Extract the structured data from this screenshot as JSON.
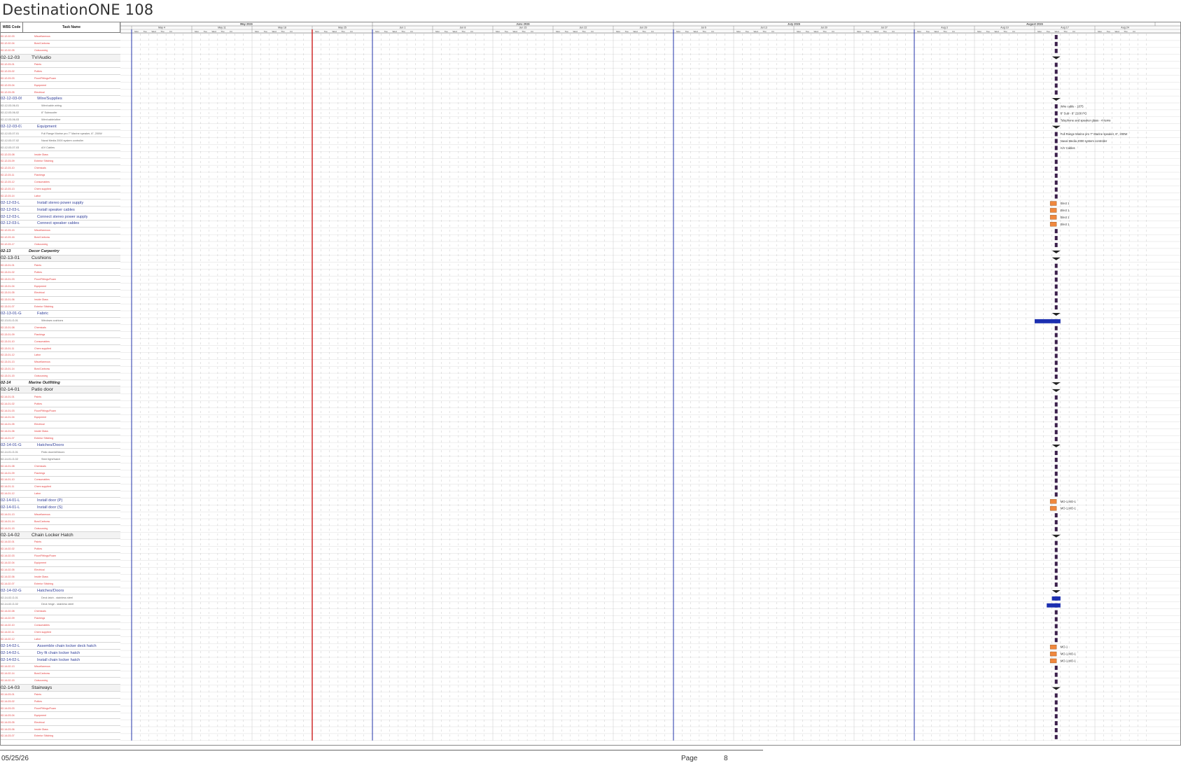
{
  "document": {
    "title": "DestinationONE 108",
    "footer": {
      "date": "05/25/26",
      "page_label": "Page",
      "page_number": "8"
    },
    "columns": {
      "wbs": "WBS Code",
      "task": "Task Name"
    },
    "months": [
      "May 2026",
      "June 2026",
      "July 2026",
      "August 2026"
    ],
    "weeks": [
      "May 4",
      "May 11",
      "May 18",
      "May 25",
      "Jun 1",
      "Jun 8",
      "Jun 15",
      "Jun 22",
      "Jun 29",
      "Jul 6",
      "Jul 13",
      "Jul 20",
      "Jul 27",
      "Aug 3",
      "Aug 10",
      "Aug 17",
      "Aug 24"
    ],
    "days": [
      "Mon",
      "Tue",
      "Wed",
      "Thu",
      "Fri"
    ],
    "colors": {
      "task_bar": "#f0883e",
      "progress_bar": "#1c2fb0",
      "milestone": "#3a1e4a",
      "today_line": "#cc1d1d",
      "month_line": "#2233aa"
    }
  },
  "rows": [
    {
      "code": "02-12-02-03",
      "name": "Miscellaneous",
      "kind": "sub"
    },
    {
      "code": "02-12-02-04",
      "name": "Bow/Carbonw",
      "kind": "sub"
    },
    {
      "code": "02-12-02-05",
      "name": "Outsourcing",
      "kind": "sub"
    },
    {
      "code": "02-12-03",
      "name": "TV/Audio",
      "kind": "sec"
    },
    {
      "code": "02-12-03-01",
      "name": "Paints",
      "kind": "sub"
    },
    {
      "code": "02-12-03-02",
      "name": "Putties",
      "kind": "sub"
    },
    {
      "code": "02-12-03-03",
      "name": "Floor/Fittings/Foam",
      "kind": "sub"
    },
    {
      "code": "02-12-03-04",
      "name": "Equipment",
      "kind": "sub"
    },
    {
      "code": "02-12-03-05",
      "name": "Electrical",
      "kind": "sub"
    },
    {
      "code": "02-12-03-06",
      "name": "Wire/Supplies",
      "kind": "grp"
    },
    {
      "code": "02-12-03-06-01",
      "name": "Wire/cable wiring",
      "kind": "item",
      "label": "Wire cable - 1875"
    },
    {
      "code": "02-12-03-06-02",
      "name": "8\" Subwoofer",
      "kind": "item",
      "label": "8\" Sub - 8\" 2100 PG"
    },
    {
      "code": "02-12-03-06-03",
      "name": "Wire/cable/other",
      "kind": "item",
      "label": "Telephone and speaker glass - 4 items"
    },
    {
      "code": "02-12-03-07",
      "name": "Equipment",
      "kind": "grp"
    },
    {
      "code": "02-12-03-07-01",
      "name": "Full Range Marine pro 7\" Marine speaker, 6\", 200W",
      "kind": "item",
      "label": "Full Range Marine pro 7\" Marine speaker, 6\", 200W"
    },
    {
      "code": "02-12-03-07-02",
      "name": "Naval Media 2000 system controller",
      "kind": "item",
      "label": "Naval Media 2000 system controller"
    },
    {
      "code": "02-12-03-07-03",
      "name": "A/V Cables",
      "kind": "item",
      "label": "A/V Cables"
    },
    {
      "code": "02-12-03-08",
      "name": "Inside Glass",
      "kind": "sub"
    },
    {
      "code": "02-12-03-09",
      "name": "Exterior Stitching",
      "kind": "sub"
    },
    {
      "code": "02-12-03-10",
      "name": "Chemicals",
      "kind": "sub"
    },
    {
      "code": "02-12-03-11",
      "name": "Flashings",
      "kind": "sub"
    },
    {
      "code": "02-12-03-12",
      "name": "Consumables",
      "kind": "sub"
    },
    {
      "code": "02-12-03-13",
      "name": "Chem supplied",
      "kind": "sub"
    },
    {
      "code": "02-12-03-14",
      "name": "Labor",
      "kind": "sub"
    },
    {
      "code": "02-12-03-L",
      "name": "Install stereo power supply",
      "kind": "task",
      "label": "Elect 1"
    },
    {
      "code": "02-12-03-L",
      "name": "Install speaker cables",
      "kind": "task",
      "label": "Elect 1"
    },
    {
      "code": "02-12-03-L",
      "name": "Connect stereo power supply",
      "kind": "task",
      "label": "Elect 1"
    },
    {
      "code": "02-12-03-L",
      "name": "Connect speaker cables",
      "kind": "task",
      "label": "Elect 1"
    },
    {
      "code": "02-12-03-15",
      "name": "Miscellaneous",
      "kind": "sub"
    },
    {
      "code": "02-12-03-16",
      "name": "Bow/Carbonw",
      "kind": "sub"
    },
    {
      "code": "02-12-03-17",
      "name": "Outsourcing",
      "kind": "sub"
    },
    {
      "code": "02-13",
      "name": "Decor Carpentry",
      "kind": "bold"
    },
    {
      "code": "02-13-01",
      "name": "Cushions",
      "kind": "sec"
    },
    {
      "code": "02-13-01-01",
      "name": "Paints",
      "kind": "sub"
    },
    {
      "code": "02-13-01-02",
      "name": "Putties",
      "kind": "sub"
    },
    {
      "code": "02-13-01-03",
      "name": "Floor/Fittings/Foam",
      "kind": "sub"
    },
    {
      "code": "02-13-01-04",
      "name": "Equipment",
      "kind": "sub"
    },
    {
      "code": "02-13-01-05",
      "name": "Electrical",
      "kind": "sub"
    },
    {
      "code": "02-13-01-06",
      "name": "Inside Glass",
      "kind": "sub"
    },
    {
      "code": "02-13-01-07",
      "name": "Exterior Stitching",
      "kind": "sub"
    },
    {
      "code": "02-13-01-G",
      "name": "Fabric",
      "kind": "grp"
    },
    {
      "code": "02-13-01-G-01",
      "name": "Windows cushions",
      "kind": "item"
    },
    {
      "code": "02-13-01-08",
      "name": "Chemicals",
      "kind": "sub"
    },
    {
      "code": "02-13-01-09",
      "name": "Flashings",
      "kind": "sub"
    },
    {
      "code": "02-13-01-10",
      "name": "Consumables",
      "kind": "sub"
    },
    {
      "code": "02-13-01-11",
      "name": "Chem supplied",
      "kind": "sub"
    },
    {
      "code": "02-13-01-12",
      "name": "Labor",
      "kind": "sub"
    },
    {
      "code": "02-13-01-13",
      "name": "Miscellaneous",
      "kind": "sub"
    },
    {
      "code": "02-13-01-14",
      "name": "Bow/Carbonw",
      "kind": "sub"
    },
    {
      "code": "02-13-01-15",
      "name": "Outsourcing",
      "kind": "sub"
    },
    {
      "code": "02-14",
      "name": "Marine Outfitting",
      "kind": "bold"
    },
    {
      "code": "02-14-01",
      "name": "Patio door",
      "kind": "sec"
    },
    {
      "code": "02-14-01-01",
      "name": "Paints",
      "kind": "sub"
    },
    {
      "code": "02-14-01-02",
      "name": "Putties",
      "kind": "sub"
    },
    {
      "code": "02-14-01-03",
      "name": "Floor/Fittings/Foam",
      "kind": "sub"
    },
    {
      "code": "02-14-01-04",
      "name": "Equipment",
      "kind": "sub"
    },
    {
      "code": "02-14-01-05",
      "name": "Electrical",
      "kind": "sub"
    },
    {
      "code": "02-14-01-06",
      "name": "Inside Glass",
      "kind": "sub"
    },
    {
      "code": "02-14-01-07",
      "name": "Exterior Stitching",
      "kind": "sub"
    },
    {
      "code": "02-14-01-G",
      "name": "Hatches/Doors",
      "kind": "grp"
    },
    {
      "code": "02-14-01-G-01",
      "name": "Patio door/sill/doors",
      "kind": "item"
    },
    {
      "code": "02-14-01-G-02",
      "name": "Steel light/hatch",
      "kind": "item"
    },
    {
      "code": "02-14-01-08",
      "name": "Chemicals",
      "kind": "sub"
    },
    {
      "code": "02-14-01-09",
      "name": "Flashings",
      "kind": "sub"
    },
    {
      "code": "02-14-01-10",
      "name": "Consumables",
      "kind": "sub"
    },
    {
      "code": "02-14-01-11",
      "name": "Chem supplied",
      "kind": "sub"
    },
    {
      "code": "02-14-01-12",
      "name": "Labor",
      "kind": "sub"
    },
    {
      "code": "02-14-01-L",
      "name": "Install door (P)",
      "kind": "task",
      "label": "MO-1,MO-1"
    },
    {
      "code": "02-14-01-L",
      "name": "Install door (S)",
      "kind": "task",
      "label": "MO-1,MO-1"
    },
    {
      "code": "02-14-01-13",
      "name": "Miscellaneous",
      "kind": "sub"
    },
    {
      "code": "02-14-01-14",
      "name": "Bow/Carbonw",
      "kind": "sub"
    },
    {
      "code": "02-14-01-15",
      "name": "Outsourcing",
      "kind": "sub"
    },
    {
      "code": "02-14-02",
      "name": "Chain Locker Hatch",
      "kind": "sec"
    },
    {
      "code": "02-14-02-01",
      "name": "Paints",
      "kind": "sub"
    },
    {
      "code": "02-14-02-02",
      "name": "Putties",
      "kind": "sub"
    },
    {
      "code": "02-14-02-03",
      "name": "Floor/Fittings/Foam",
      "kind": "sub"
    },
    {
      "code": "02-14-02-04",
      "name": "Equipment",
      "kind": "sub"
    },
    {
      "code": "02-14-02-05",
      "name": "Electrical",
      "kind": "sub"
    },
    {
      "code": "02-14-02-06",
      "name": "Inside Glass",
      "kind": "sub"
    },
    {
      "code": "02-14-02-07",
      "name": "Exterior Stitching",
      "kind": "sub"
    },
    {
      "code": "02-14-02-G",
      "name": "Hatches/Doors",
      "kind": "grp"
    },
    {
      "code": "02-14-02-G-01",
      "name": "Deck latch - stainless steel",
      "kind": "item"
    },
    {
      "code": "02-14-02-G-02",
      "name": "Deck hinge - stainless steel",
      "kind": "item"
    },
    {
      "code": "02-14-02-08",
      "name": "Chemicals",
      "kind": "sub"
    },
    {
      "code": "02-14-02-09",
      "name": "Flashings",
      "kind": "sub"
    },
    {
      "code": "02-14-02-10",
      "name": "Consumables",
      "kind": "sub"
    },
    {
      "code": "02-14-02-11",
      "name": "Chem supplied",
      "kind": "sub"
    },
    {
      "code": "02-14-02-12",
      "name": "Labor",
      "kind": "sub"
    },
    {
      "code": "02-14-02-L",
      "name": "Assemble chain locker deck hatch",
      "kind": "task",
      "label": "MO-1"
    },
    {
      "code": "02-14-02-L",
      "name": "Dry fit chain locker hatch",
      "kind": "task",
      "label": "MO-1,MO-1"
    },
    {
      "code": "02-14-02-L",
      "name": "Install chain locker hatch",
      "kind": "task",
      "label": "MO-1,MO-1"
    },
    {
      "code": "02-14-02-13",
      "name": "Miscellaneous",
      "kind": "sub"
    },
    {
      "code": "02-14-02-14",
      "name": "Bow/Carbonw",
      "kind": "sub"
    },
    {
      "code": "02-14-02-15",
      "name": "Outsourcing",
      "kind": "sub"
    },
    {
      "code": "02-14-03",
      "name": "Stairways",
      "kind": "sec"
    },
    {
      "code": "02-14-03-01",
      "name": "Paints",
      "kind": "sub"
    },
    {
      "code": "02-14-03-02",
      "name": "Putties",
      "kind": "sub"
    },
    {
      "code": "02-14-03-03",
      "name": "Floor/Fittings/Foam",
      "kind": "sub"
    },
    {
      "code": "02-14-03-04",
      "name": "Equipment",
      "kind": "sub"
    },
    {
      "code": "02-14-03-05",
      "name": "Electrical",
      "kind": "sub"
    },
    {
      "code": "02-14-03-06",
      "name": "Inside Glass",
      "kind": "sub"
    },
    {
      "code": "02-14-03-07",
      "name": "Exterior Stitching",
      "kind": "sub"
    }
  ]
}
